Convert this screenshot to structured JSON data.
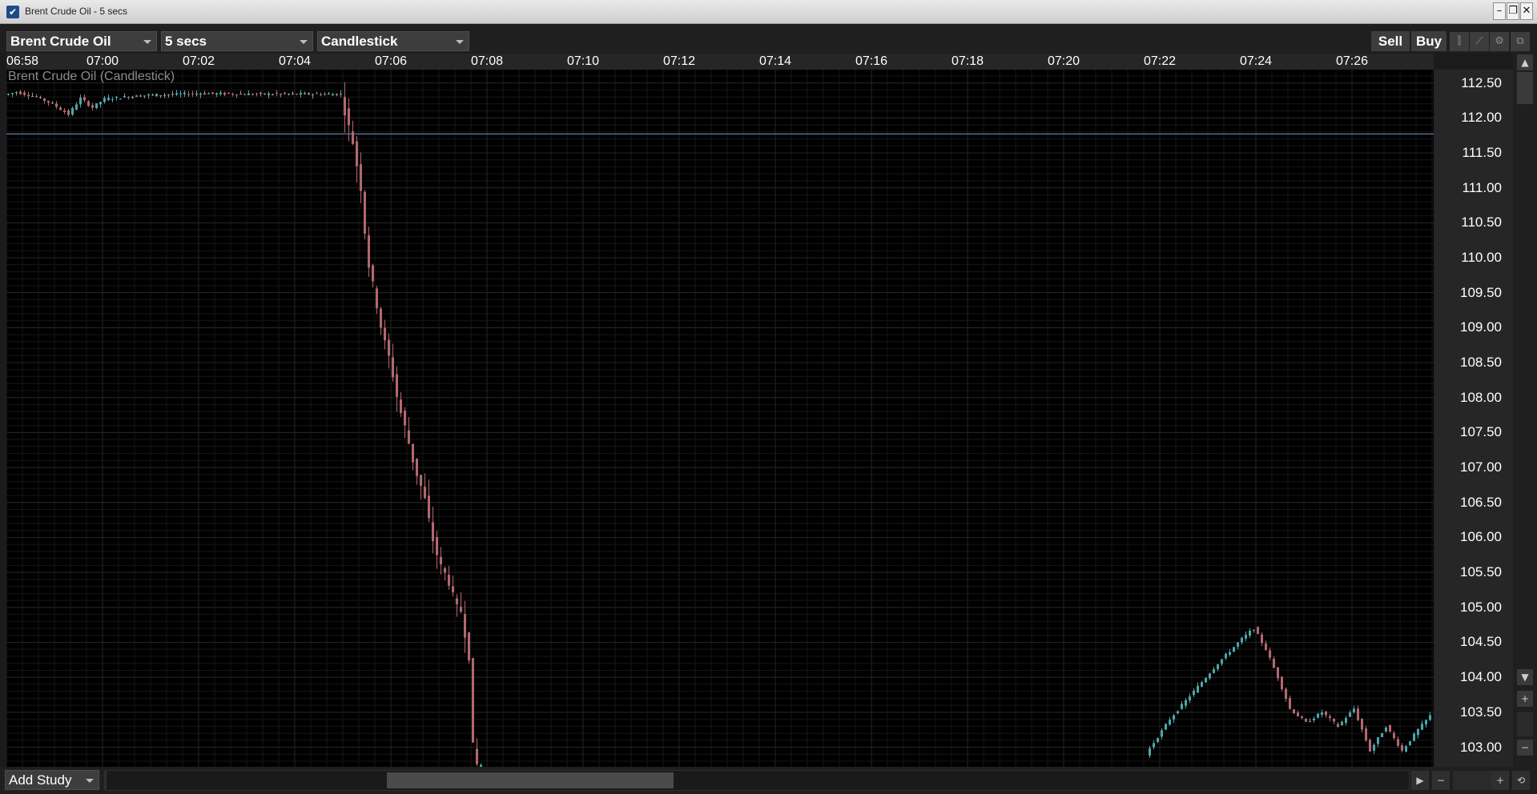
{
  "window": {
    "title": "Brent Crude Oil - 5 secs",
    "app_icon": "checkmark-icon",
    "controls": [
      "minimize-icon",
      "restore-icon",
      "close-icon"
    ]
  },
  "toolbar": {
    "instrument": "Brent Crude Oil",
    "interval": "5 secs",
    "chart_style": "Candlestick",
    "sell_label": "Sell",
    "buy_label": "Buy",
    "tools": [
      "candle-tool-icon",
      "draw-line-icon",
      "chart-settings-icon",
      "detach-window-icon"
    ]
  },
  "bottom": {
    "add_study_label": "Add Study"
  },
  "colors": {
    "up": "#4fa5a8",
    "down": "#b3686f",
    "flat": "#9a9a9a",
    "reference_line": "#5f7fa6",
    "plot_bg": "#000000",
    "panel_bg": "#262626"
  },
  "chart_data": {
    "type": "candlestick",
    "title": "Brent Crude Oil (Candlestick)",
    "x_tick_labels": [
      "06:58",
      "07:00",
      "07:02",
      "07:04",
      "07:06",
      "07:08",
      "07:10",
      "07:12",
      "07:14",
      "07:16",
      "07:18",
      "07:20",
      "07:22",
      "07:24",
      "07:26"
    ],
    "y_tick_labels": [
      "112.50",
      "112.00",
      "111.50",
      "111.00",
      "110.50",
      "110.00",
      "109.50",
      "109.00",
      "108.50",
      "108.00",
      "107.50",
      "107.00",
      "106.50",
      "106.00",
      "105.50",
      "105.00",
      "104.50",
      "104.00",
      "103.50",
      "103.00"
    ],
    "ylim": [
      102.72,
      112.69
    ],
    "xlim": [
      "06:58",
      "07:27:42"
    ],
    "reference_line": 111.77,
    "grid": true,
    "series": [
      {
        "from": "06:58:00",
        "to": "07:05:00",
        "path": [
          [
            0,
            112.33
          ],
          [
            15,
            112.37
          ],
          [
            40,
            112.3
          ],
          [
            60,
            112.2
          ],
          [
            80,
            112.05
          ],
          [
            95,
            112.28
          ],
          [
            110,
            112.15
          ],
          [
            125,
            112.27
          ],
          [
            170,
            112.32
          ],
          [
            220,
            112.34
          ],
          [
            245,
            112.35
          ],
          [
            299,
            112.34
          ]
        ]
      },
      {
        "from": "07:05:00",
        "to": "07:07:55",
        "path": [
          [
            0,
            112.34
          ],
          [
            8,
            111.95
          ],
          [
            15,
            111.65
          ],
          [
            25,
            111.0
          ],
          [
            33,
            110.0
          ],
          [
            42,
            109.5
          ],
          [
            52,
            108.9
          ],
          [
            62,
            108.5
          ],
          [
            72,
            107.9
          ],
          [
            82,
            107.5
          ],
          [
            92,
            107.0
          ],
          [
            104,
            106.6
          ],
          [
            114,
            106.0
          ],
          [
            124,
            105.6
          ],
          [
            134,
            105.4
          ],
          [
            144,
            105.0
          ],
          [
            150,
            104.95
          ],
          [
            160,
            104.3
          ],
          [
            166,
            102.75
          ],
          [
            174,
            102.75
          ]
        ]
      },
      {
        "from": "07:21:45",
        "to": "07:27:40",
        "path": [
          [
            0,
            102.9
          ],
          [
            30,
            103.4
          ],
          [
            60,
            103.8
          ],
          [
            90,
            104.2
          ],
          [
            120,
            104.55
          ],
          [
            135,
            104.7
          ],
          [
            150,
            104.4
          ],
          [
            165,
            104.0
          ],
          [
            180,
            103.55
          ],
          [
            200,
            103.35
          ],
          [
            220,
            103.5
          ],
          [
            240,
            103.3
          ],
          [
            260,
            103.55
          ],
          [
            280,
            102.95
          ],
          [
            300,
            103.3
          ],
          [
            320,
            102.95
          ],
          [
            340,
            103.25
          ],
          [
            355,
            103.45
          ]
        ]
      }
    ]
  }
}
